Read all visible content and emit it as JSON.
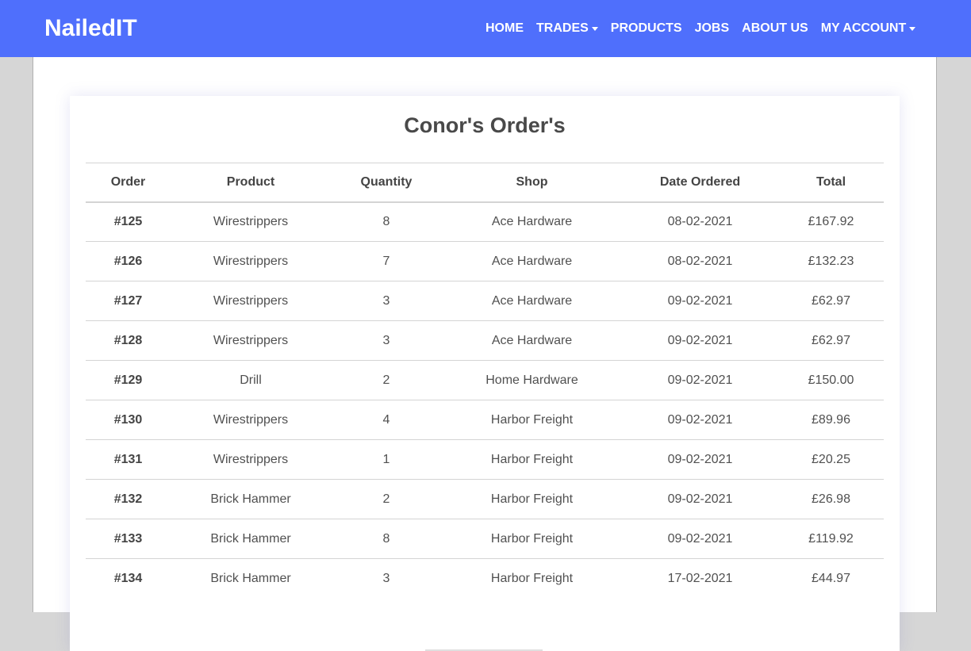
{
  "navbar": {
    "brand": "NailedIT",
    "items": [
      {
        "label": "HOME",
        "dropdown": false
      },
      {
        "label": "TRADES",
        "dropdown": true
      },
      {
        "label": "PRODUCTS",
        "dropdown": false
      },
      {
        "label": "JOBS",
        "dropdown": false
      },
      {
        "label": "ABOUT US",
        "dropdown": false
      },
      {
        "label": "MY ACCOUNT",
        "dropdown": true
      }
    ],
    "color": "#4f6ffc"
  },
  "orders": {
    "title": "Conor's Order's",
    "columns": [
      "Order",
      "Product",
      "Quantity",
      "Shop",
      "Date Ordered",
      "Total"
    ],
    "rows": [
      {
        "order": "#125",
        "product": "Wirestrippers",
        "quantity": "8",
        "shop": "Ace Hardware",
        "date": "08-02-2021",
        "total": "£167.92"
      },
      {
        "order": "#126",
        "product": "Wirestrippers",
        "quantity": "7",
        "shop": "Ace Hardware",
        "date": "08-02-2021",
        "total": "£132.23"
      },
      {
        "order": "#127",
        "product": "Wirestrippers",
        "quantity": "3",
        "shop": "Ace Hardware",
        "date": "09-02-2021",
        "total": "£62.97"
      },
      {
        "order": "#128",
        "product": "Wirestrippers",
        "quantity": "3",
        "shop": "Ace Hardware",
        "date": "09-02-2021",
        "total": "£62.97"
      },
      {
        "order": "#129",
        "product": "Drill",
        "quantity": "2",
        "shop": "Home Hardware",
        "date": "09-02-2021",
        "total": "£150.00"
      },
      {
        "order": "#130",
        "product": "Wirestrippers",
        "quantity": "4",
        "shop": "Harbor Freight",
        "date": "09-02-2021",
        "total": "£89.96"
      },
      {
        "order": "#131",
        "product": "Wirestrippers",
        "quantity": "1",
        "shop": "Harbor Freight",
        "date": "09-02-2021",
        "total": "£20.25"
      },
      {
        "order": "#132",
        "product": "Brick Hammer",
        "quantity": "2",
        "shop": "Harbor Freight",
        "date": "09-02-2021",
        "total": "£26.98"
      },
      {
        "order": "#133",
        "product": "Brick Hammer",
        "quantity": "8",
        "shop": "Harbor Freight",
        "date": "09-02-2021",
        "total": "£119.92"
      },
      {
        "order": "#134",
        "product": "Brick Hammer",
        "quantity": "3",
        "shop": "Harbor Freight",
        "date": "17-02-2021",
        "total": "£44.97"
      }
    ]
  }
}
